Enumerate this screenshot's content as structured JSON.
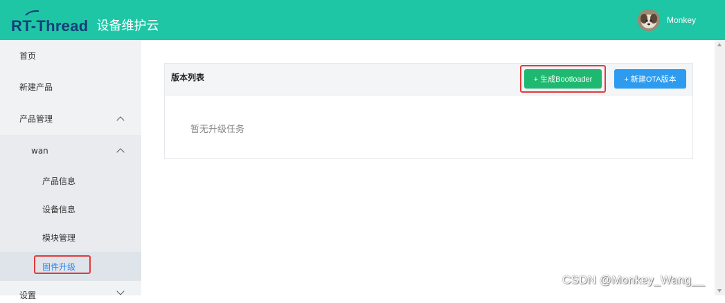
{
  "header": {
    "logo_text": "RT-Thread",
    "app_name": "设备维护云",
    "user_name": "Monkey",
    "bar_color": "#1ec6a6"
  },
  "sidebar": {
    "home": "首页",
    "new_product": "新建产品",
    "product_management": "产品管理",
    "product_group": "wan",
    "product_info": "产品信息",
    "device_info": "设备信息",
    "module_management": "模块管理",
    "firmware_upgrade": "固件升级",
    "settings": "设置"
  },
  "main": {
    "panel_title": "版本列表",
    "generate_bootloader_label": "+ 生成Bootloader",
    "new_ota_label": "+ 新建OTA版本",
    "empty_text": "暂无升级任务",
    "green": "#1fb870",
    "blue": "#2d9bef",
    "highlight": "#e23a3a"
  },
  "watermark": "CSDN @Monkey_Wang__"
}
